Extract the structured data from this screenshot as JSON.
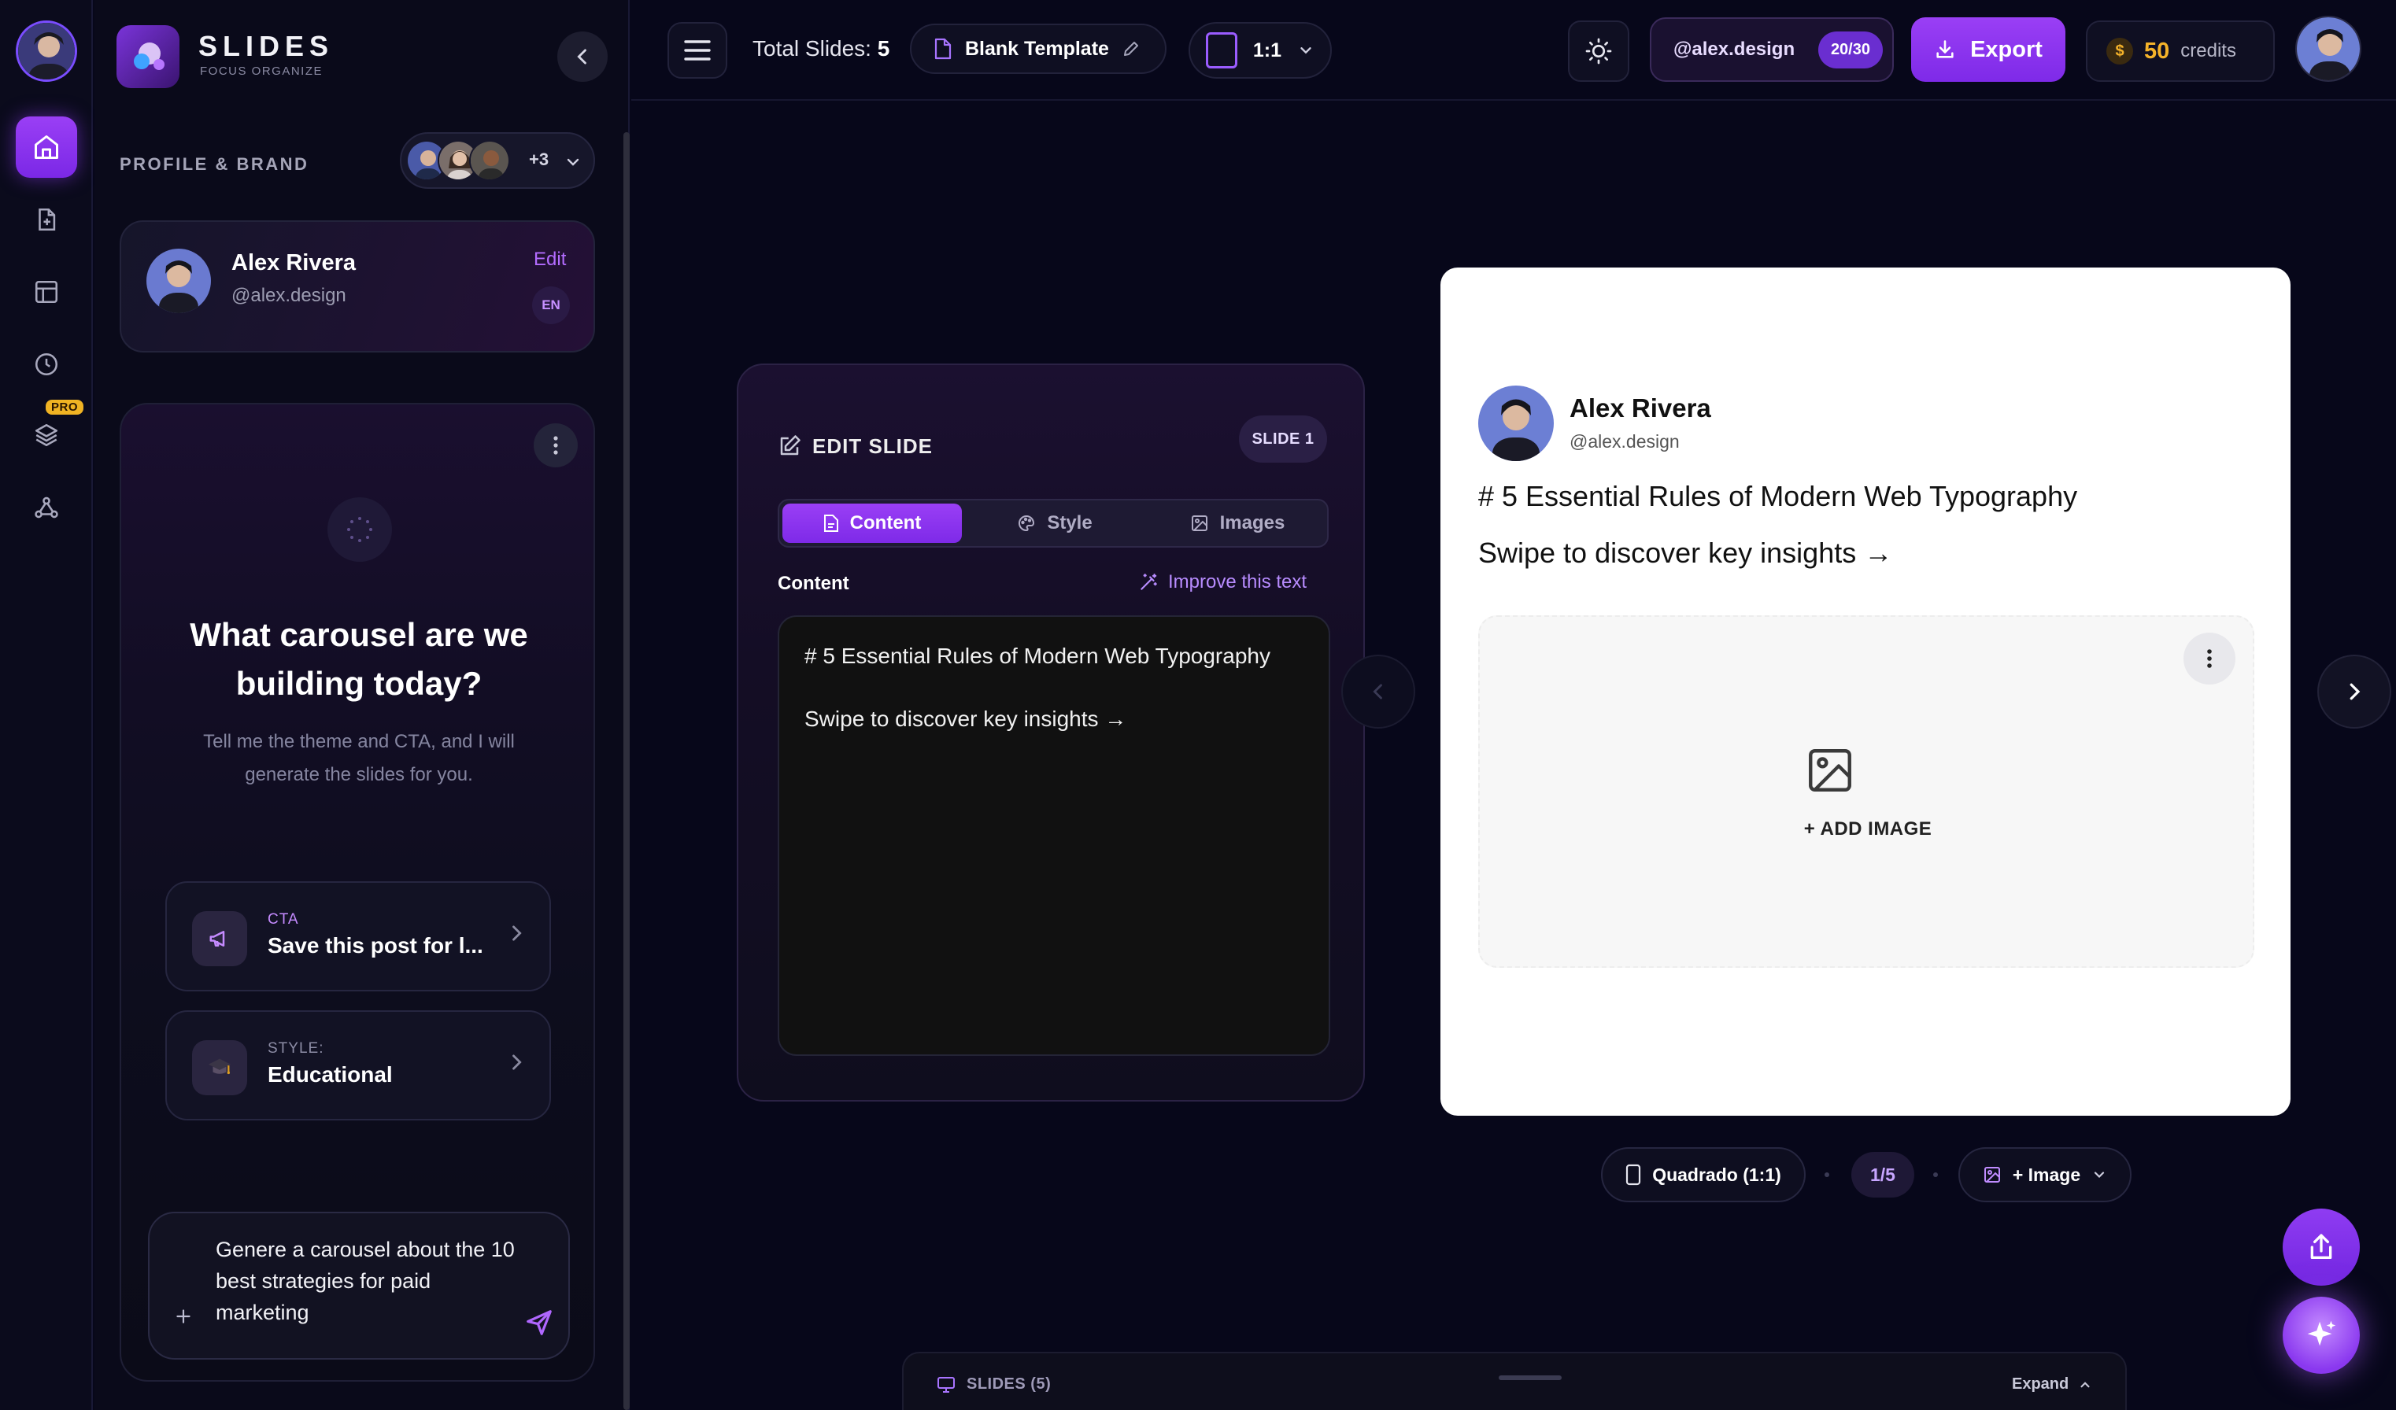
{
  "app": {
    "title": "SLIDES",
    "subtitle": "FOCUS ORGANIZE"
  },
  "sidebar": {
    "section_label": "PROFILE & BRAND",
    "collab_more": "+3",
    "profile": {
      "name": "Alex Rivera",
      "handle": "@alex.design",
      "edit_label": "Edit",
      "lang": "EN"
    },
    "chat": {
      "heading": "What carousel are we building today?",
      "subtext": "Tell me the theme and CTA, and I will generate the slides for you.",
      "options": [
        {
          "label": "CTA",
          "value": "Save this post for l...",
          "label_color": "#c58bff"
        },
        {
          "label": "STYLE:",
          "value": "Educational",
          "label_color": "#8d8da6"
        }
      ],
      "prompt": "Genere a carousel about the 10 best strategies for paid marketing"
    }
  },
  "rail": {
    "pro_badge": "PRO",
    "items": [
      "home-icon",
      "new-file-icon",
      "layout-icon",
      "history-icon",
      "layers-icon",
      "share-network-icon"
    ]
  },
  "topbar": {
    "total_label": "Total Slides:",
    "total_value": "5",
    "template_label": "Blank Template",
    "ratio_label": "1:1",
    "handle": "@alex.design",
    "quota": "20/30",
    "export_label": "Export",
    "credits_value": "50",
    "credits_label": "credits"
  },
  "editor": {
    "title": "EDIT SLIDE",
    "slide_badge": "SLIDE 1",
    "tabs": [
      "Content",
      "Style",
      "Images"
    ],
    "active_tab": "Content",
    "content_label": "Content",
    "improve_label": "Improve this text",
    "lines": [
      "# 5 Essential Rules of Modern Web Typography",
      "Swipe to discover key insights →"
    ]
  },
  "preview": {
    "name": "Alex Rivera",
    "handle": "@alex.design",
    "line1": "# 5 Essential Rules of Modern Web Typography",
    "line2": "Swipe to discover key insights →",
    "add_image_label": "+ ADD IMAGE"
  },
  "bottom": {
    "format_label": "Quadrado (1:1)",
    "page_indicator": "1/5",
    "image_label": "+ Image",
    "drawer_label": "SLIDES (5)",
    "expand_label": "Expand"
  },
  "colors": {
    "accent": "#8b33ee",
    "background": "#07071a",
    "credits": "#f5b32a"
  }
}
